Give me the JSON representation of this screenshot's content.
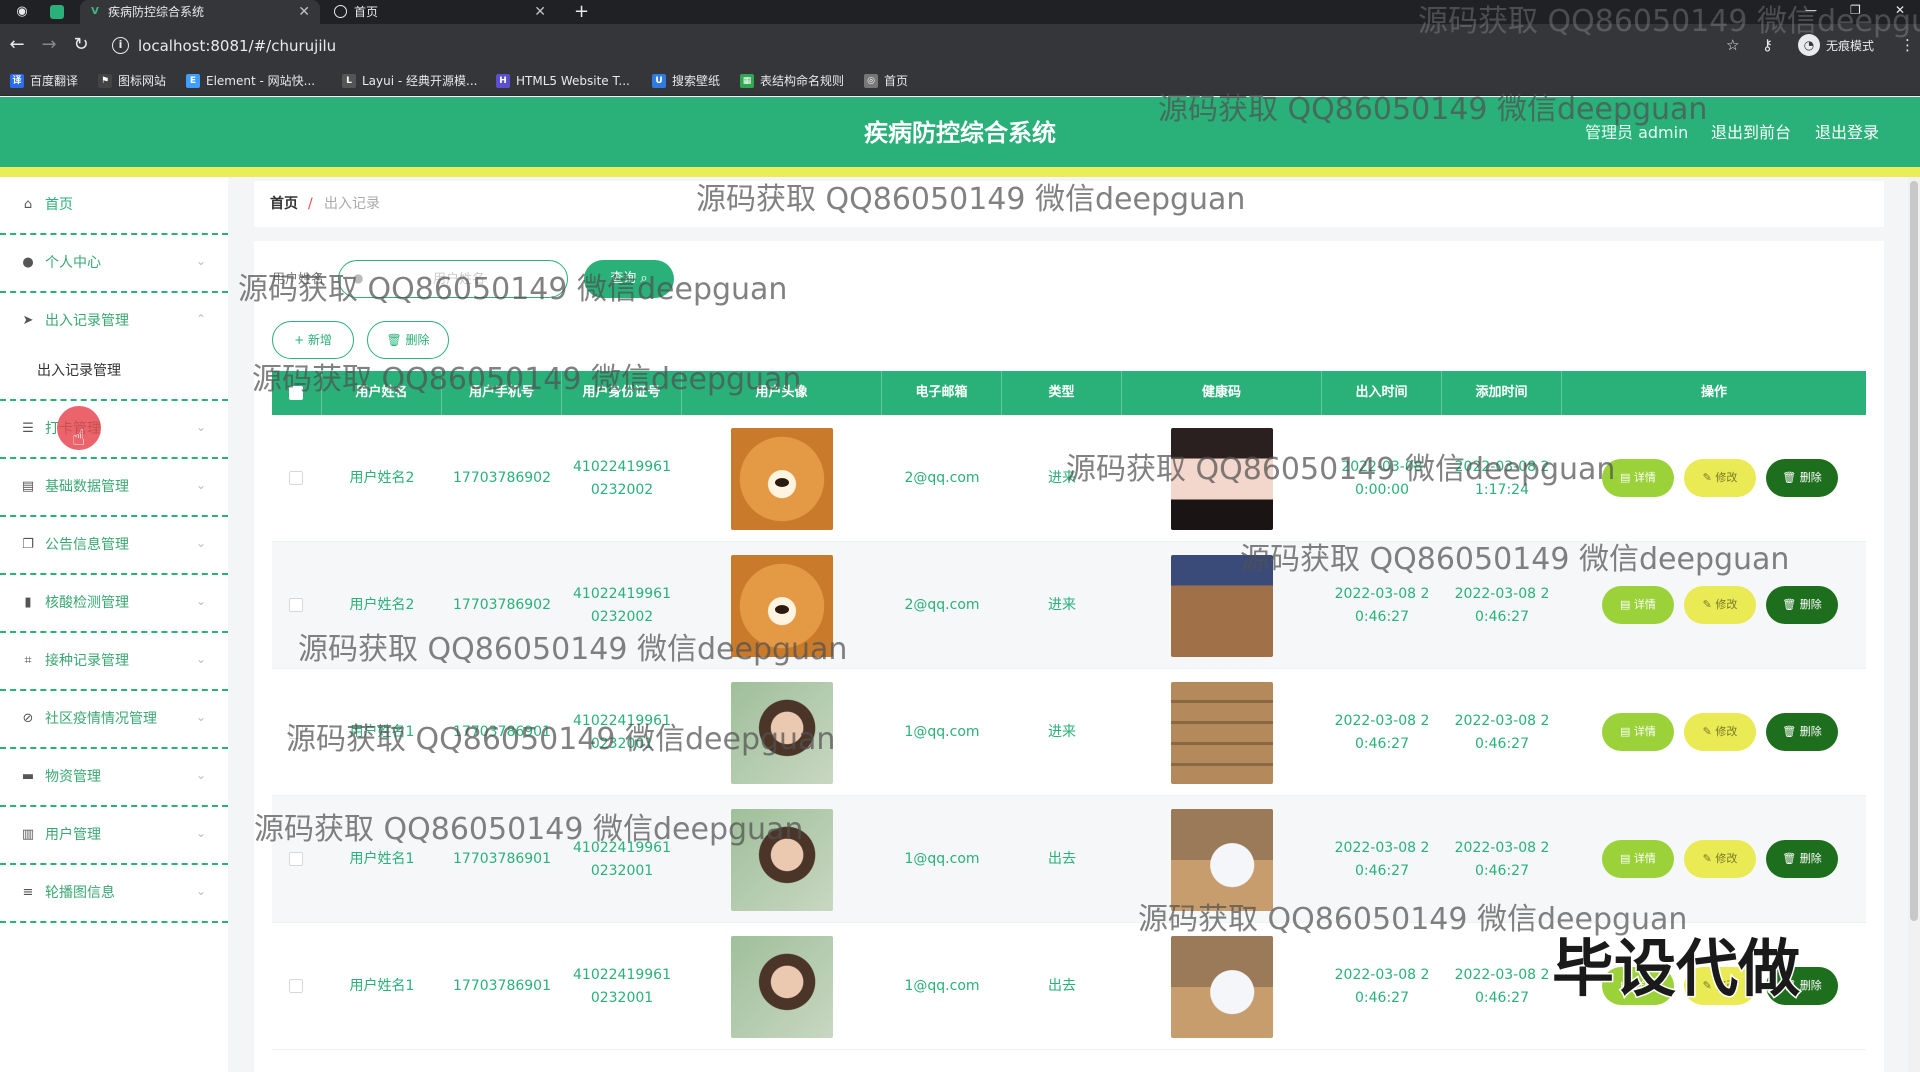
{
  "browser": {
    "tabs": [
      {
        "title": "疾病防控综合系统",
        "active": true,
        "favicon": "V"
      },
      {
        "title": "首页",
        "active": false,
        "favicon": "globe"
      }
    ],
    "url": "localhost:8081/#/churujilu",
    "incognito_label": "无痕模式",
    "bookmarks": [
      {
        "label": "百度翻译",
        "color": "#2a6df4"
      },
      {
        "label": "图标网站",
        "color": "#444444"
      },
      {
        "label": "Element - 网站快...",
        "color": "#409eff"
      },
      {
        "label": "Layui - 经典开源模...",
        "color": "#555555"
      },
      {
        "label": "HTML5 Website T...",
        "color": "#5b4fcf"
      },
      {
        "label": "搜索壁纸",
        "color": "#2f7be0"
      },
      {
        "label": "表结构命名规则",
        "color": "#2fa84f"
      },
      {
        "label": "首页",
        "color": "#777777"
      }
    ]
  },
  "header": {
    "title": "疾病防控综合系统",
    "admin_label": "管理员 admin",
    "front_label": "退出到前台",
    "logout_label": "退出登录",
    "bg_color": "#29b179",
    "strip_color": "#ecec57"
  },
  "sidebar": {
    "items": [
      {
        "label": "首页",
        "icon": "home-icon",
        "glyph": "⌂",
        "arrow": ""
      },
      {
        "label": "个人中心",
        "icon": "user-icon",
        "glyph": "●",
        "arrow": "⌄"
      },
      {
        "label": "出入记录管理",
        "icon": "send-icon",
        "glyph": "➤",
        "arrow": "⌃"
      },
      {
        "label": "打卡管理",
        "icon": "list-icon",
        "glyph": "☰",
        "arrow": "⌄"
      },
      {
        "label": "基础数据管理",
        "icon": "database-icon",
        "glyph": "▤",
        "arrow": "⌄"
      },
      {
        "label": "公告信息管理",
        "icon": "copy-icon",
        "glyph": "❐",
        "arrow": "⌄"
      },
      {
        "label": "核酸检测管理",
        "icon": "bar-chart-icon",
        "glyph": "▮",
        "arrow": "⌄"
      },
      {
        "label": "接种记录管理",
        "icon": "crop-icon",
        "glyph": "⌗",
        "arrow": "⌄"
      },
      {
        "label": "社区疫情情况管理",
        "icon": "compass-icon",
        "glyph": "⊘",
        "arrow": "⌄"
      },
      {
        "label": "物资管理",
        "icon": "box-icon",
        "glyph": "▬",
        "arrow": "⌄"
      },
      {
        "label": "用户管理",
        "icon": "trash-icon",
        "glyph": "▥",
        "arrow": "⌄"
      },
      {
        "label": "轮播图信息",
        "icon": "sliders-icon",
        "glyph": "≡",
        "arrow": "⌄"
      }
    ],
    "submenu_label": "出入记录管理"
  },
  "breadcrumb": {
    "home": "首页",
    "sep": "/",
    "current": "出入记录"
  },
  "search": {
    "label": "用户姓名",
    "placeholder": "用户姓名",
    "button_label": "查询 ⌕"
  },
  "actions": {
    "add_label": "+ 新增",
    "delete_label": "🗑 删除"
  },
  "table": {
    "columns": [
      "用户姓名",
      "用户手机号",
      "用户身份证号",
      "用户头像",
      "电子邮箱",
      "类型",
      "健康码",
      "出入时间",
      "添加时间",
      "操作"
    ],
    "rows": [
      {
        "name": "用户姓名2",
        "phone": "17703786902",
        "id_line1": "41022419961",
        "id_line2": "0232002",
        "avatar": "shiba",
        "email": "2@qq.com",
        "type": "进来",
        "health": "girl1",
        "time1": "2022-03-08",
        "time2": "0:00:00",
        "add1": "2022-03-08 2",
        "add2": "1:17:24"
      },
      {
        "name": "用户姓名2",
        "phone": "17703786902",
        "id_line1": "41022419961",
        "id_line2": "0232002",
        "avatar": "shiba",
        "email": "2@qq.com",
        "type": "进来",
        "health": "room",
        "time1": "2022-03-08 2",
        "time2": "0:46:27",
        "add1": "2022-03-08 2",
        "add2": "0:46:27"
      },
      {
        "name": "用户姓名1",
        "phone": "17703786901",
        "id_line1": "41022419961",
        "id_line2": "0232001",
        "avatar": "girl2",
        "email": "1@qq.com",
        "type": "进来",
        "health": "boxes",
        "time1": "2022-03-08 2",
        "time2": "0:46:27",
        "add1": "2022-03-08 2",
        "add2": "0:46:27"
      },
      {
        "name": "用户姓名1",
        "phone": "17703786901",
        "id_line1": "41022419961",
        "id_line2": "0232001",
        "avatar": "girl2",
        "email": "1@qq.com",
        "type": "出去",
        "health": "worker",
        "time1": "2022-03-08 2",
        "time2": "0:46:27",
        "add1": "2022-03-08 2",
        "add2": "0:46:27"
      },
      {
        "name": "用户姓名1",
        "phone": "17703786901",
        "id_line1": "41022419961",
        "id_line2": "0232001",
        "avatar": "girl2",
        "email": "1@qq.com",
        "type": "出去",
        "health": "worker",
        "time1": "2022-03-08 2",
        "time2": "0:46:27",
        "add1": "2022-03-08 2",
        "add2": "0:46:27"
      }
    ],
    "op_detail": "▤ 详情",
    "op_edit": "✎ 修改",
    "op_delete": "🗑 删除"
  },
  "watermark": {
    "text": "源码获取 QQ86050149 微信deepguan",
    "stamp": "毕设代做"
  }
}
